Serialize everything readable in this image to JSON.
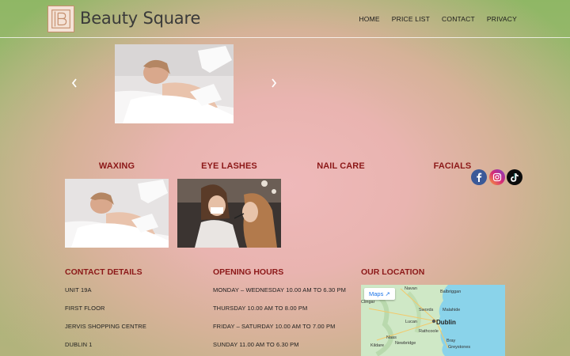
{
  "header": {
    "brand": "Beauty Square",
    "nav": [
      "HOME",
      "PRICE LIST",
      "CONTACT",
      "PRIVACY"
    ]
  },
  "services": [
    "WAXING",
    "EYE LASHES",
    "NAIL CARE",
    "FACIALS"
  ],
  "social": [
    "facebook-icon",
    "instagram-icon",
    "tiktok-icon"
  ],
  "contact": {
    "title": "CONTACT DETAILS",
    "lines": [
      "UNIT 19A",
      "FIRST FLOOR",
      "JERVIS SHOPPING CENTRE",
      "DUBLIN 1"
    ]
  },
  "hours": {
    "title": "OPENING HOURS",
    "lines": [
      "MONDAY – WEDNESDAY 10.00 AM TO 6.30 PM",
      "THURSDAY 10.00 AM TO 8.00 PM",
      "FRIDAY – SATURDAY 10.00 AM TO 7.00 PM",
      "SUNDAY 11.00 AM TO 6.30 PM"
    ]
  },
  "location": {
    "title": "OUR LOCATION",
    "maps_label": "Maps",
    "places": [
      "Navan",
      "Balbriggan",
      "Swords",
      "Malahide",
      "Dublin",
      "Lucan",
      "Naas",
      "Rathcoole",
      "Newbridge",
      "Bray",
      "Greystones",
      "Kildare",
      "Clingar"
    ]
  },
  "colors": {
    "accent": "#8c1818",
    "brand_text": "#3a3a3a"
  }
}
